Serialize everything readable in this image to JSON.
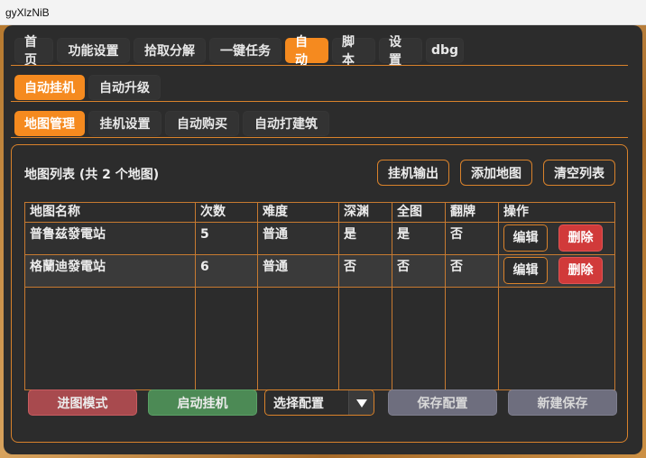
{
  "window": {
    "title": "gyXlzNiB"
  },
  "main_tabs": [
    "首页",
    "功能设置",
    "拾取分解",
    "一键任务",
    "自动",
    "脚本",
    "设置",
    "dbg"
  ],
  "sub_tabs": [
    "自动挂机",
    "自动升级"
  ],
  "sub2_tabs": [
    "地图管理",
    "挂机设置",
    "自动购买",
    "自动打建筑"
  ],
  "map_list": {
    "title": "地图列表 (共 2 个地图)",
    "buttons": {
      "output": "挂机输出",
      "add": "添加地图",
      "clear": "清空列表"
    },
    "columns": [
      "地图名称",
      "次数",
      "难度",
      "深渊",
      "全图",
      "翻牌",
      "操作"
    ],
    "rows": [
      {
        "name": "普鲁兹發電站",
        "count": "5",
        "difficulty": "普通",
        "abyss": "是",
        "fullmap": "是",
        "flip": "否",
        "edit": "编辑",
        "delete": "删除"
      },
      {
        "name": "格蘭迪發電站",
        "count": "6",
        "difficulty": "普通",
        "abyss": "否",
        "fullmap": "否",
        "flip": "否",
        "edit": "编辑",
        "delete": "删除"
      }
    ]
  },
  "bottom": {
    "enter_mode": "进图模式",
    "start": "启动挂机",
    "select_config": "选择配置",
    "save_config": "保存配置",
    "new_save": "新建保存"
  },
  "colors": {
    "accent": "#f58a1f",
    "danger": "#d13a3a",
    "enter_mode": "#a84a4e",
    "start": "#4c8a55",
    "disabled": "#6e6e7e"
  }
}
